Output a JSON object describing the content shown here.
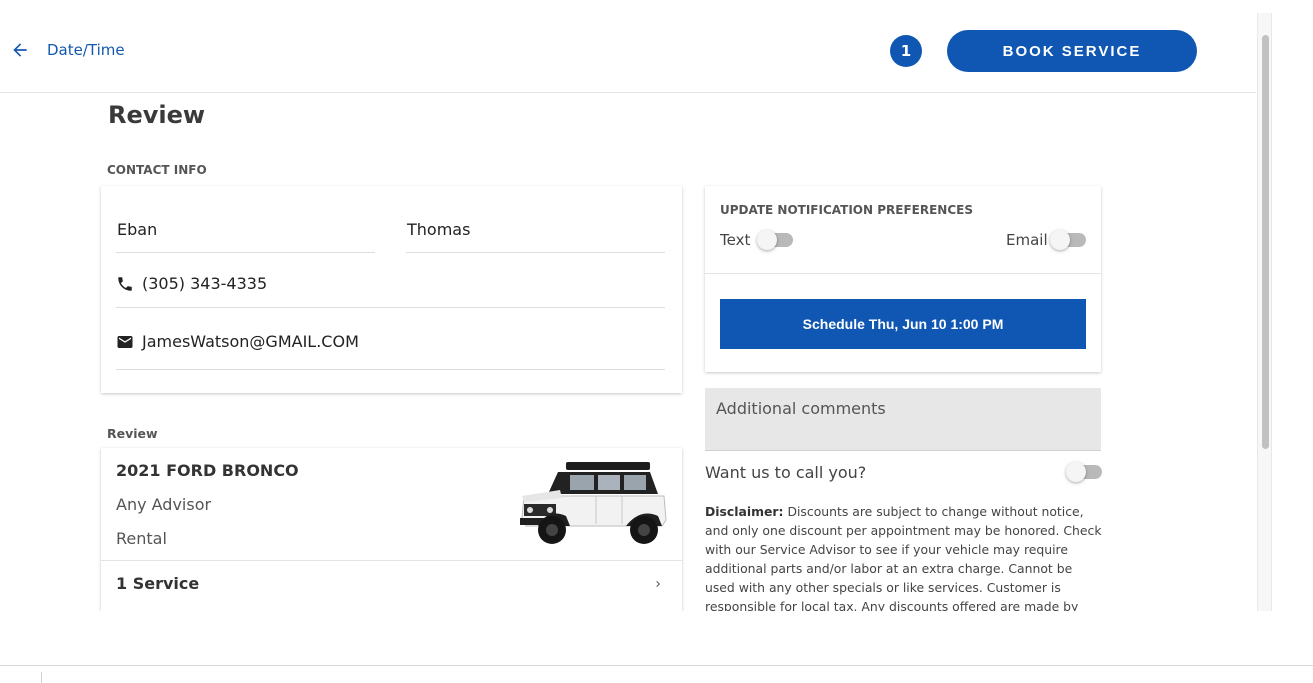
{
  "header": {
    "back_label": "Date/Time",
    "cart_count": "1",
    "book_label": "BOOK SERVICE"
  },
  "page": {
    "title": "Review"
  },
  "contact": {
    "section_label": "CONTACT INFO",
    "first_name": "Eban",
    "last_name": "Thomas",
    "phone": "(305) 343-4335",
    "email": "JamesWatson@GMAIL.COM"
  },
  "notifications": {
    "title": "UPDATE NOTIFICATION PREFERENCES",
    "text_label": "Text",
    "email_label": "Email",
    "text_enabled": false,
    "email_enabled": false
  },
  "schedule": {
    "label": "Schedule Thu, Jun 10 1:00 PM"
  },
  "comments": {
    "placeholder": "Additional comments"
  },
  "callback": {
    "label": "Want us to call you?",
    "enabled": false
  },
  "disclaimer": {
    "heading": "Disclaimer:",
    "text": "Discounts are subject to change without notice, and only one discount per appointment may be honored. Check with our Service Advisor to see if your vehicle may require additional parts and/or labor at an extra charge. Cannot be used with any other specials or like services. Customer is responsible for local tax. Any discounts offered are made by the dealer, who is solely"
  },
  "review": {
    "section_label": "Review",
    "vehicle": "2021 FORD BRONCO",
    "advisor": "Any Advisor",
    "transport": "Rental",
    "services_label": "1 Service"
  },
  "colors": {
    "accent": "#0f57b3",
    "link": "#1558b0"
  }
}
